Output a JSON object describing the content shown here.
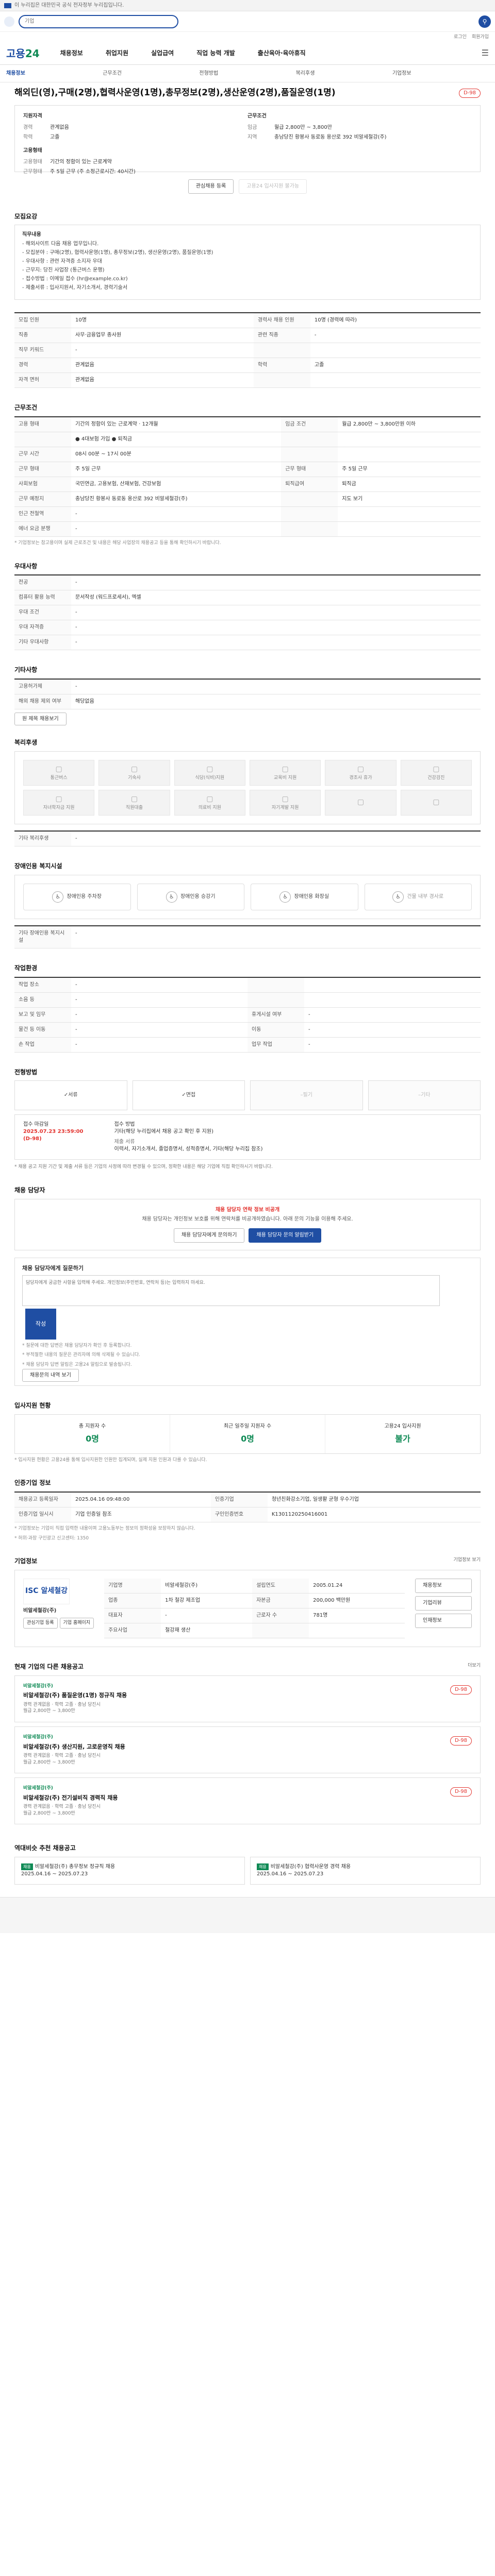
{
  "browser": {
    "notice": "이 누리집은 대한민국 공식 전자정부 누리집입니다."
  },
  "search": {
    "value": "",
    "placeholder": "기업"
  },
  "util": [
    "로그인",
    "회원가입"
  ],
  "brand": {
    "name_a": "고용",
    "name_b": "24"
  },
  "gnb": [
    "채용정보",
    "취업지원",
    "실업급여",
    "직업 능력 개발",
    "출산육아·육아휴직"
  ],
  "subnav": [
    "채용정보",
    "근무조건",
    "전형방법",
    "복리후생",
    "기업정보"
  ],
  "job": {
    "title": "해외딘(영),구매(2명),협력사운영(1명),총무정보(2명),생산운영(2명),품질운영(1명)",
    "dday": "D-98",
    "summary_left_title": "지원자격",
    "summary_right_title": "근무조건",
    "left": [
      {
        "k": "경력",
        "v": "관계없음"
      },
      {
        "k": "학력",
        "v": "고졸"
      }
    ],
    "right": [
      {
        "k": "임금",
        "v": "월급 2,800만 ~ 3,800만"
      },
      {
        "k": "지역",
        "v": "충남당진 황봉사 동로동 용산로 392 비알세철강(주)"
      }
    ],
    "left2_title": "고용형태",
    "left2": [
      {
        "k": "고용형태",
        "v": "기간의 정함이 있는 근로계약"
      },
      {
        "k": "근무형태",
        "v": "주 5일 근무 (주 소정근로시간: 40시간)"
      }
    ],
    "btn_scrap": "관심채용 등록",
    "btn_apply": "고용24 입사지원 불가능"
  },
  "sec_recruit": {
    "title": "모집요강",
    "lab": "직무내용",
    "lines": [
      "- 해외사이트 다음 채용 업무입니다.",
      "- 모집분야 : 구매(2명), 협력사운영(1명), 총무정보(2명), 생산운영(2명), 품질운영(1명)",
      "- 우대사항 : 관련 자격증 소지자 우대",
      "- 근무지: 당진 사업장 (통근버스 운행)",
      "- 접수방법 : 이메일 접수 (hr@example.co.kr)",
      "- 제출서류 : 입사지원서, 자기소개서, 경력기술서"
    ],
    "rows": [
      {
        "k": "모집 인원",
        "v": "10명",
        "k2": "경력사 채용 인원",
        "v2": "10명 (경력에 따라)"
      },
      {
        "k": "직종",
        "v": "사무·금융업무 종사원",
        "k2": "관련 직종",
        "v2": "-"
      },
      {
        "k": "직무 키워드",
        "v": "-",
        "k2": "",
        "v2": ""
      },
      {
        "k": "경력",
        "v": "관계없음",
        "k2": "학력",
        "v2": "고졸"
      },
      {
        "k": "자격 면허",
        "v": "관계없음",
        "k2": "",
        "v2": ""
      }
    ]
  },
  "sec_cond": {
    "title": "근무조건",
    "rows": [
      {
        "k": "고용 형태",
        "v": "기간의 정함이 있는 근로계약 · 12개월",
        "k2": "임금 조건",
        "v2": "월급 2,800만 ~ 3,800만원 이하"
      },
      {
        "k": "",
        "v": "● 4대보험 가입  ● 퇴직금",
        "k2": "",
        "v2": ""
      },
      {
        "k": "근무 시간",
        "v": "08시 00분 ~ 17시 00분",
        "k2": "",
        "v2": ""
      },
      {
        "k": "근무 형태",
        "v": "주 5일 근무",
        "k2": "근무 형태",
        "v2": "주 5일 근무"
      },
      {
        "k": "사회보험",
        "v": "국민연금, 고용보험, 산재보험, 건강보험",
        "k2": "퇴직급여",
        "v2": "퇴직금"
      },
      {
        "k": "근무 예정지",
        "v": "충남당진 황봉사 동로동 용산로 392 비알세철강(주)",
        "k2": "",
        "v2": "지도 보기"
      },
      {
        "k": "인근 전철역",
        "v": "-",
        "k2": "",
        "v2": ""
      },
      {
        "k": "에너 요금 분쟁",
        "v": "-",
        "k2": "",
        "v2": ""
      }
    ],
    "note": "* 기업정보는 참고용이며 실제 근로조건 및 내용은 해당 사업장의 채용공고 등을 통해 확인하시기 바랍니다."
  },
  "sec_pref": {
    "title": "우대사항",
    "rows": [
      {
        "k": "전공",
        "v": "-"
      },
      {
        "k": "컴퓨터 활용 능력",
        "v": "문서작성 (워드프로세서), 엑셀"
      },
      {
        "k": "우대 조건",
        "v": "-"
      },
      {
        "k": "우대 자격증",
        "v": "-"
      },
      {
        "k": "기타 우대사항",
        "v": "-"
      }
    ]
  },
  "sec_etc": {
    "title": "기타사항",
    "rows": [
      {
        "k": "고용허가제",
        "v": "-"
      },
      {
        "k": "해외 채용 제외 여부",
        "v": "해당없음"
      }
    ],
    "btn": "원 제목 채용보기"
  },
  "sec_welfare": {
    "title": "복리후생",
    "items": [
      "통근버스",
      "기숙사",
      "식당(식비)지원",
      "교육비 지원",
      "경조사 휴가",
      "건강검진",
      "자녀학자금 지원",
      "직원대출",
      "의료비 지원",
      "자기계발 지원",
      "",
      ""
    ],
    "note_label": "기타 복리후생",
    "note": "-"
  },
  "sec_disab": {
    "title": "장애인용 복지시설",
    "items": [
      "장애인용 주차장",
      "장애인용 승강기",
      "장애인용 화장실",
      "건물 내부 경사로"
    ],
    "note_label": "기타 장애인용 복지시설",
    "note": "-"
  },
  "sec_workenv": {
    "title": "작업환경",
    "rows": [
      {
        "k": "작업 장소",
        "v": "-",
        "k2": "",
        "v2": ""
      },
      {
        "k": "소음 등",
        "v": "-",
        "k2": "",
        "v2": ""
      },
      {
        "k": "보고 및 임무",
        "v": "-",
        "k2": "휴게시설 여부",
        "v2": "-"
      },
      {
        "k": "물건 등 이동",
        "v": "-",
        "k2": "이동",
        "v2": "-"
      },
      {
        "k": "손 작업",
        "v": "-",
        "k2": "업무 작업",
        "v2": "-"
      }
    ]
  },
  "sec_method": {
    "title": "전형방법",
    "items": [
      {
        "label": "서류",
        "off": false
      },
      {
        "label": "면접",
        "off": false
      },
      {
        "label": "필기",
        "off": true
      },
      {
        "label": "기타",
        "off": true
      }
    ],
    "period_label": "접수 마감일",
    "period_value": "2025.07.23 23:59:00",
    "period_sub": "(D-98)",
    "method_label": "접수 방법",
    "method_value": "기타(해당 누리집에서 채용 공고 확인 후 지원)",
    "method_sub": "제출 서류",
    "method_sub_v": "이력서, 자기소개서, 졸업증명서, 성적증명서, 기타(해당 누리집 참조)",
    "notice": "* 채용 공고 지원 기간 및 제출 서류 등은 기업의 사정에 따라 변경될 수 있으며, 정확한 내용은 해당 기업에 직접 확인하시기 바랍니다."
  },
  "sec_contact": {
    "title": "채용 담당자",
    "alert_head": "채용 담당자 연락 정보 비공개",
    "alert_text": "채용 담당자는 개인정보 보호를 위해 연락처를 비공개하였습니다. 아래 문의 기능을 이용해 주세요.",
    "btn_a": "채용 담당자에게 문의하기",
    "btn_b": "채용 담당자 문의 알림받기",
    "q_title": "채용 담당자에게 질문하기",
    "q_placeholder": "담당자에게 궁금한 사항을 입력해 주세요. 개인정보(주민번호, 연락처 등)는 입력하지 마세요.",
    "q_send": "작성",
    "q_notes": [
      "* 질문에 대한 답변은 채용 담당자가 확인 후 등록합니다.",
      "* 부적절한 내용의 질문은 관리자에 의해 삭제될 수 있습니다.",
      "* 채용 담당자 답변 알림은 고용24 알림으로 발송됩니다."
    ],
    "q_btn": "채용문의 내역 보기"
  },
  "sec_apply": {
    "title": "입사지원 현황",
    "stats": [
      {
        "label": "총 지원자 수",
        "value": "0명"
      },
      {
        "label": "최근 일주일 지원자 수",
        "value": "0명"
      },
      {
        "label": "고용24 입사지원",
        "value": "불가"
      }
    ],
    "note": "* 입사지원 현황은 고용24를 통해 입사지원한 인원만 집계되며, 실제 지원 인원과 다를 수 있습니다."
  },
  "sec_info": {
    "title": "인증기업 정보",
    "rows": [
      {
        "k": "채용공고 등록일자",
        "v": "2025.04.16 09:48:00",
        "k2": "인증기업",
        "v2": "청년친화강소기업, 일생활 균형 우수기업"
      },
      {
        "k": "인증기업 일시시",
        "v": "기업 인증일 참조",
        "k2": "구인인증번호",
        "v2": "K1301120250416001"
      }
    ],
    "note": "* 기업정보는 기업이 직접 입력한 내용이며 고용노동부는 정보의 정확성을 보장하지 않습니다.",
    "note2": "* 허위·과장 구인광고 신고센터: 1350"
  },
  "sec_company": {
    "title": "기업정보",
    "link": "기업정보 보기",
    "logo": "ISC 알세철강",
    "name": "비알세철강(주)",
    "btns": [
      "관심기업 등록",
      "기업 홈페이지"
    ],
    "rows": [
      {
        "k": "기업명",
        "v": "비알세철강(주)",
        "k2": "설립연도",
        "v2": "2005.01.24"
      },
      {
        "k": "업종",
        "v": "1차 철강 제조업",
        "k2": "자본금",
        "v2": "200,000 백만원"
      },
      {
        "k": "대표자",
        "v": "-",
        "k2": "근로자 수",
        "v2": "781명"
      },
      {
        "k": "주요사업",
        "v": "철강재 생산",
        "k2": "",
        "v2": ""
      }
    ],
    "side_btns": [
      "채용정보",
      "기업리뷰",
      "인재정보"
    ]
  },
  "sec_same": {
    "title": "현재 기업의 다른 채용공고",
    "more": "더보기",
    "items": [
      {
        "co": "비알세철강(주)",
        "title": "비알세철강(주) 품질운영(1명) 정규직 채용",
        "meta": "경력 관계없음 · 학력 고졸 · 충남 당진시",
        "sal": "월급 2,800만 ~ 3,800만",
        "dday": "D-98"
      },
      {
        "co": "비알세철강(주)",
        "title": "비알세철강(주) 생산지원, 고로운영직 채용",
        "meta": "경력 관계없음 · 학력 고졸 · 충남 당진시",
        "sal": "월급 2,800만 ~ 3,800만",
        "dday": "D-98"
      },
      {
        "co": "비알세철강(주)",
        "title": "비알세철강(주) 전기설비직 경력직 채용",
        "meta": "경력 관계없음 · 학력 고졸 · 충남 당진시",
        "sal": "월급 2,800만 ~ 3,800만",
        "dday": "D-98"
      }
    ]
  },
  "sec_rec": {
    "title": "역대비슷 추천 채용공고",
    "items": [
      {
        "tag": "채용",
        "title": "비알세철강(주) 총무정보 정규직 채용",
        "meta": "2025.04.16 ~ 2025.07.23"
      },
      {
        "tag": "채용",
        "title": "비알세철강(주) 협력사운영 경력 채용",
        "meta": "2025.04.16 ~ 2025.07.23"
      }
    ]
  }
}
